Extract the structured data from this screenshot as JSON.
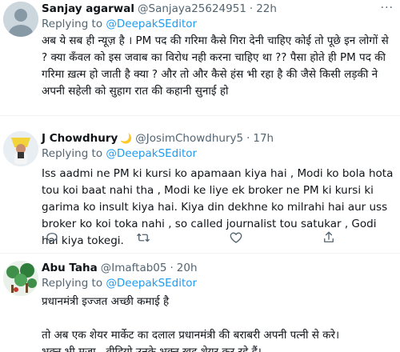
{
  "tweets": [
    {
      "name": "Sanjay agarwal",
      "handle": "@Sanjaya25624951",
      "dot": "·",
      "time": "22h",
      "replying_prefix": "Replying to ",
      "replying_to": "@DeepakSEditor",
      "text": "अब ये सब ही न्यूज़ है । PM पद की गरिमा कैसे गिरा देनी चाहिए कोई तो पूछे इन लोगों से ? क्या कँवल को इस जवाब का विरोध नही करना चाहिए था ?? पैसा होते ही PM पद की गरिमा ख़त्म हो जाती है क्या ? और तो और कैसे हंस भी रहा है की जैसे किसी लड़की ने अपनी सहेली को सुहाग रात की कहानी सुनाई हो"
    },
    {
      "name": "J Chowdhury",
      "name_emoji": "🌙",
      "handle": "@JosimChowdhury5",
      "dot": "·",
      "time": "17h",
      "replying_prefix": "Replying to ",
      "replying_to": "@DeepakSEditor",
      "text": "Iss aadmi ne PM ki kursi ko apamaan kiya hai , Modi ko bola hota tou koi baat nahi tha , Modi ke liye ek broker ne PM ki kursi ki garima ko insult kiya hai. Kiya din dekhne ko milrahi hai aur uss broker ko koi toka nahi , so called journalist tou satukar , Godi hai kiya tokegi."
    },
    {
      "name": "Abu Taha",
      "handle": "@Imaftab05",
      "dot": "·",
      "time": "20h",
      "replying_prefix": "Replying to ",
      "replying_to": "@DeepakSEditor",
      "text_line1": "प्रधानमंत्री इज्जत अच्छी कमाई है",
      "text_line2": "तो अब एक शेयर मार्केट का दलाल प्रधानमंत्री की बराबरी अपनी पत्नी से करे।",
      "text_line3": "भक्त भी मजा,,,वीडियो उनके भक्त खुद शेयर कर रहे हैं।"
    }
  ],
  "more_glyph": "···",
  "icons": [
    "reply-icon",
    "retweet-icon",
    "like-icon",
    "share-icon",
    "more-icon"
  ],
  "colors": {
    "accent": "#1d9bf0",
    "secondary": "#536471",
    "divider": "#eff3f4"
  }
}
